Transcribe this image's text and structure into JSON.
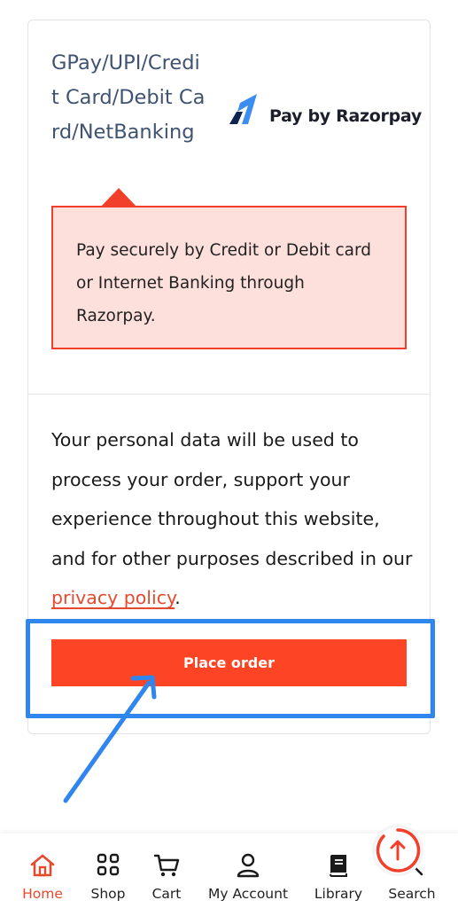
{
  "payment": {
    "method_label": "GPay/UPI/Credit Card/Debit Card/NetBanking",
    "brand_text": "Pay by Razorpay",
    "description": "Pay securely by Credit or Debit card or Internet Banking through Razorpay."
  },
  "privacy": {
    "text": "Your personal data will be used to process your order, support your experience throughout this website, and for other purposes described in our ",
    "link_label": "privacy policy",
    "suffix": "."
  },
  "actions": {
    "place_order_label": "Place order"
  },
  "nav": {
    "items": [
      {
        "label": "Home",
        "icon": "home-icon",
        "active": true
      },
      {
        "label": "Shop",
        "icon": "grid-icon"
      },
      {
        "label": "Cart",
        "icon": "cart-icon"
      },
      {
        "label": "My Account",
        "icon": "user-icon"
      },
      {
        "label": "Library",
        "icon": "book-icon"
      },
      {
        "label": "Search",
        "icon": "search-icon"
      }
    ]
  },
  "colors": {
    "accent": "#fd4526",
    "highlight": "#2f86ef",
    "notice_bg": "#fde0dc",
    "method_text": "#3f5271"
  }
}
